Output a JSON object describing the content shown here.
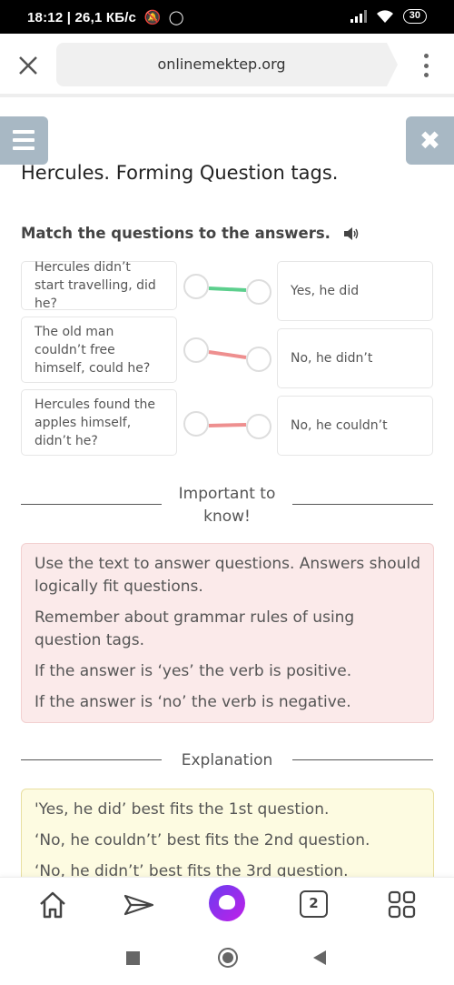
{
  "status_bar": {
    "time_speed": "18:12 | 26,1 КБ/с",
    "icons": [
      "mute-bell-icon",
      "whatsapp-icon"
    ],
    "battery": "30"
  },
  "browser": {
    "url": "onlinemektep.org"
  },
  "page": {
    "title": "Hercules. Forming Question tags.",
    "instruction": "Match the questions to the answers.",
    "questions": [
      "Hercules didn’t start travelling, did he?",
      "The old man couldn’t free himself, could he?",
      "Hercules found the apples himself, didn’t he?"
    ],
    "answers": [
      "Yes, he did",
      "No, he didn’t",
      "No, he couldn’t"
    ],
    "matches": [
      {
        "question": 0,
        "answer": 0,
        "status": "correct"
      },
      {
        "question": 1,
        "answer": 1,
        "status": "incorrect"
      },
      {
        "question": 2,
        "answer": 2,
        "status": "incorrect"
      }
    ],
    "colors": {
      "correct": "#5ccf8d",
      "incorrect": "#ee8f8f",
      "side_button": "#a8b8c4"
    },
    "important_heading": "Important to know!",
    "important_heading_line1": "Important to",
    "important_heading_line2": "know!",
    "important_items": [
      "Use the text to answer questions. Answers should logically fit questions.",
      "Remember about grammar rules of using question tags.",
      "If the answer is ‘yes’ the verb is positive.",
      "If the answer is ‘no’ the verb is negative."
    ],
    "explanation_heading": "Explanation",
    "explanation_items": [
      "'Yes, he did’ best fits the 1st question.",
      "‘No, he couldn’t’ best fits the 2nd question.",
      "‘No, he didn’t’ best fits the 3rd question."
    ]
  },
  "bottom_nav": {
    "tabs_count": "2"
  }
}
